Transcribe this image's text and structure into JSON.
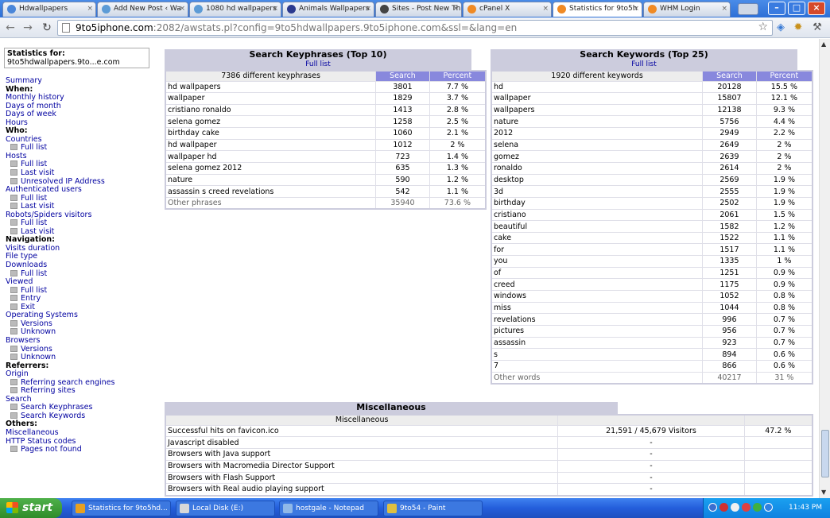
{
  "browser": {
    "tabs": [
      {
        "label": "Hdwallpapers",
        "color": "#4a86d9"
      },
      {
        "label": "Add New Post ‹ Wa",
        "color": "#5c9bd6"
      },
      {
        "label": "1080 hd wallpapers",
        "color": "#5c9bd6"
      },
      {
        "label": "Animals Wallpapers",
        "color": "#2b3a8f"
      },
      {
        "label": "Sites - Post New Th",
        "color": "#444444"
      },
      {
        "label": "cPanel X",
        "color": "#f08a24"
      },
      {
        "label": "Statistics for 9to5h",
        "color": "#f08a24"
      },
      {
        "label": "WHM Login",
        "color": "#f08a24"
      }
    ],
    "url_host": "9to5iphone.com",
    "url_rest": ":2082/awstats.pl?config=9to5hdwallpapers.9to5iphone.com&ssl=&lang=en",
    "icons": {
      "back": "back-arrow-icon",
      "forward": "forward-arrow-icon",
      "reload": "reload-icon",
      "star": "star-icon",
      "wrench": "wrench-icon"
    }
  },
  "sidebar": {
    "stats_label": "Statistics for:",
    "stats_site": "9to5hdwallpapers.9to...e.com",
    "items": [
      {
        "t": "l",
        "text": "Summary"
      },
      {
        "t": "h",
        "text": "When:"
      },
      {
        "t": "l",
        "text": "Monthly history"
      },
      {
        "t": "l",
        "text": "Days of month"
      },
      {
        "t": "l",
        "text": "Days of week"
      },
      {
        "t": "l",
        "text": "Hours"
      },
      {
        "t": "h",
        "text": "Who:"
      },
      {
        "t": "l",
        "text": "Countries"
      },
      {
        "t": "s",
        "text": "Full list"
      },
      {
        "t": "l",
        "text": "Hosts"
      },
      {
        "t": "s",
        "text": "Full list"
      },
      {
        "t": "s",
        "text": "Last visit"
      },
      {
        "t": "s",
        "text": "Unresolved IP Address"
      },
      {
        "t": "l",
        "text": "Authenticated users"
      },
      {
        "t": "s",
        "text": "Full list"
      },
      {
        "t": "s",
        "text": "Last visit"
      },
      {
        "t": "l",
        "text": "Robots/Spiders visitors"
      },
      {
        "t": "s",
        "text": "Full list"
      },
      {
        "t": "s",
        "text": "Last visit"
      },
      {
        "t": "h",
        "text": "Navigation:"
      },
      {
        "t": "l",
        "text": "Visits duration"
      },
      {
        "t": "l",
        "text": "File type"
      },
      {
        "t": "l",
        "text": "Downloads"
      },
      {
        "t": "s",
        "text": "Full list"
      },
      {
        "t": "l",
        "text": "Viewed"
      },
      {
        "t": "s",
        "text": "Full list"
      },
      {
        "t": "s",
        "text": "Entry"
      },
      {
        "t": "s",
        "text": "Exit"
      },
      {
        "t": "l",
        "text": "Operating Systems"
      },
      {
        "t": "s",
        "text": "Versions"
      },
      {
        "t": "s",
        "text": "Unknown"
      },
      {
        "t": "l",
        "text": "Browsers"
      },
      {
        "t": "s",
        "text": "Versions"
      },
      {
        "t": "s",
        "text": "Unknown"
      },
      {
        "t": "h",
        "text": "Referrers:"
      },
      {
        "t": "l",
        "text": "Origin"
      },
      {
        "t": "s",
        "text": "Referring search engines"
      },
      {
        "t": "s",
        "text": "Referring sites"
      },
      {
        "t": "l",
        "text": "Search"
      },
      {
        "t": "s",
        "text": "Search Keyphrases"
      },
      {
        "t": "s",
        "text": "Search Keywords"
      },
      {
        "t": "h",
        "text": "Others:"
      },
      {
        "t": "l",
        "text": "Miscellaneous"
      },
      {
        "t": "l",
        "text": "HTTP Status codes"
      },
      {
        "t": "s",
        "text": "Pages not found"
      }
    ]
  },
  "keyphrases": {
    "title": "Search Keyphrases (Top 10)",
    "full_list": "Full list",
    "count_label": "7386 different keyphrases",
    "col_search": "Search",
    "col_percent": "Percent",
    "rows": [
      [
        "hd wallpapers",
        "3801",
        "7.7 %"
      ],
      [
        "wallpaper",
        "1829",
        "3.7 %"
      ],
      [
        "cristiano ronaldo",
        "1413",
        "2.8 %"
      ],
      [
        "selena gomez",
        "1258",
        "2.5 %"
      ],
      [
        "birthday cake",
        "1060",
        "2.1 %"
      ],
      [
        "hd wallpaper",
        "1012",
        "2 %"
      ],
      [
        "wallpaper hd",
        "723",
        "1.4 %"
      ],
      [
        "selena gomez 2012",
        "635",
        "1.3 %"
      ],
      [
        "nature",
        "590",
        "1.2 %"
      ],
      [
        "assassin s creed revelations",
        "542",
        "1.1 %"
      ]
    ],
    "other": [
      "Other phrases",
      "35940",
      "73.6 %"
    ]
  },
  "keywords": {
    "title": "Search Keywords (Top 25)",
    "full_list": "Full list",
    "count_label": "1920 different keywords",
    "col_search": "Search",
    "col_percent": "Percent",
    "rows": [
      [
        "hd",
        "20128",
        "15.5 %"
      ],
      [
        "wallpaper",
        "15807",
        "12.1 %"
      ],
      [
        "wallpapers",
        "12138",
        "9.3 %"
      ],
      [
        "nature",
        "5756",
        "4.4 %"
      ],
      [
        "2012",
        "2949",
        "2.2 %"
      ],
      [
        "selena",
        "2649",
        "2 %"
      ],
      [
        "gomez",
        "2639",
        "2 %"
      ],
      [
        "ronaldo",
        "2614",
        "2 %"
      ],
      [
        "desktop",
        "2569",
        "1.9 %"
      ],
      [
        "3d",
        "2555",
        "1.9 %"
      ],
      [
        "birthday",
        "2502",
        "1.9 %"
      ],
      [
        "cristiano",
        "2061",
        "1.5 %"
      ],
      [
        "beautiful",
        "1582",
        "1.2 %"
      ],
      [
        "cake",
        "1522",
        "1.1 %"
      ],
      [
        "for",
        "1517",
        "1.1 %"
      ],
      [
        "you",
        "1335",
        "1 %"
      ],
      [
        "of",
        "1251",
        "0.9 %"
      ],
      [
        "creed",
        "1175",
        "0.9 %"
      ],
      [
        "windows",
        "1052",
        "0.8 %"
      ],
      [
        "miss",
        "1044",
        "0.8 %"
      ],
      [
        "revelations",
        "996",
        "0.7 %"
      ],
      [
        "pictures",
        "956",
        "0.7 %"
      ],
      [
        "assassin",
        "923",
        "0.7 %"
      ],
      [
        "s",
        "894",
        "0.6 %"
      ],
      [
        "7",
        "866",
        "0.6 %"
      ]
    ],
    "other": [
      "Other words",
      "40217",
      "31 %"
    ]
  },
  "misc": {
    "title": "Miscellaneous",
    "header": "Miscellaneous",
    "rows": [
      [
        "Successful hits on favicon.ico",
        "21,591 / 45,679 Visitors",
        "47.2 %"
      ],
      [
        "Javascript disabled",
        "-",
        ""
      ],
      [
        "Browsers with Java support",
        "-",
        ""
      ],
      [
        "Browsers with Macromedia Director Support",
        "-",
        ""
      ],
      [
        "Browsers with Flash Support",
        "-",
        ""
      ],
      [
        "Browsers with Real audio playing support",
        "-",
        ""
      ]
    ]
  },
  "taskbar": {
    "start": "start",
    "tasks": [
      {
        "label": "Statistics for 9to5hd...",
        "color": "#e8a020"
      },
      {
        "label": "Local Disk (E:)",
        "color": "#d8d8d8"
      },
      {
        "label": "hostgale - Notepad",
        "color": "#8fb8e8"
      },
      {
        "label": "9to54 - Paint",
        "color": "#e0c040"
      }
    ],
    "clock": "11:43 PM"
  },
  "colors": {
    "accent_header": "#8888dd",
    "title_bg": "#ccccdd",
    "link": "#0000a0"
  }
}
